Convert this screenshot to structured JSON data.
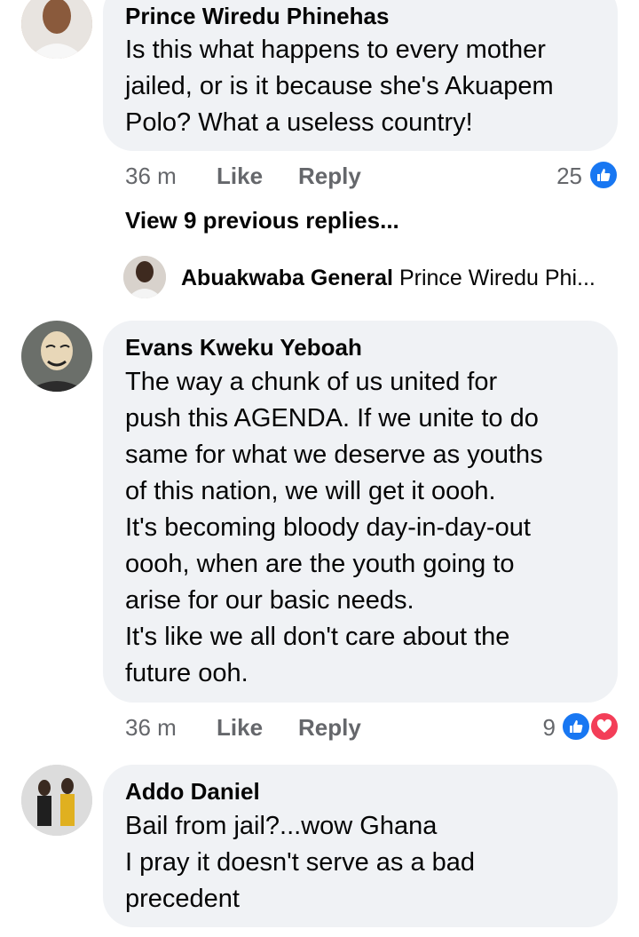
{
  "comments": [
    {
      "author": "Prince Wiredu Phinehas",
      "text": "Is this what happens to every mother jailed, or is it because she's Akuapem Polo? What a useless country!",
      "line1": "Is this what happens to every mother",
      "line2": "jailed, or is it because she's Akuapem",
      "line3": "Polo? What a useless country!",
      "time": "36 m",
      "like_label": "Like",
      "reply_label": "Reply",
      "reaction_count": "25",
      "reactions": [
        "like"
      ]
    },
    {
      "author": "Evans Kweku Yeboah",
      "line1": "The way a chunk of us united for",
      "line2": "push this AGENDA. If we unite to do",
      "line3": "same for what we deserve as youths",
      "line4": "of this nation, we will get it oooh.",
      "line5": "It's becoming bloody day-in-day-out",
      "line6": "oooh, when are the youth going to",
      "line7": "arise for our basic needs.",
      "line8": "It's like we all don't care about the",
      "line9": "future ooh.",
      "time": "36 m",
      "like_label": "Like",
      "reply_label": "Reply",
      "reaction_count": "9",
      "reactions": [
        "like",
        "love"
      ]
    },
    {
      "author": "Addo Daniel",
      "line1": "Bail from jail?...wow Ghana",
      "line2": "I pray it doesn't serve as a bad",
      "line3": "precedent"
    }
  ],
  "view_previous": "View 9 previous replies...",
  "reply_preview": {
    "author": "Abuakwaba General",
    "snippet": "Prince Wiredu Phi..."
  },
  "colors": {
    "bubble": "#f0f2f5",
    "meta": "#65676b",
    "like_blue": "#1877f2",
    "love_red": "#f33e58"
  }
}
